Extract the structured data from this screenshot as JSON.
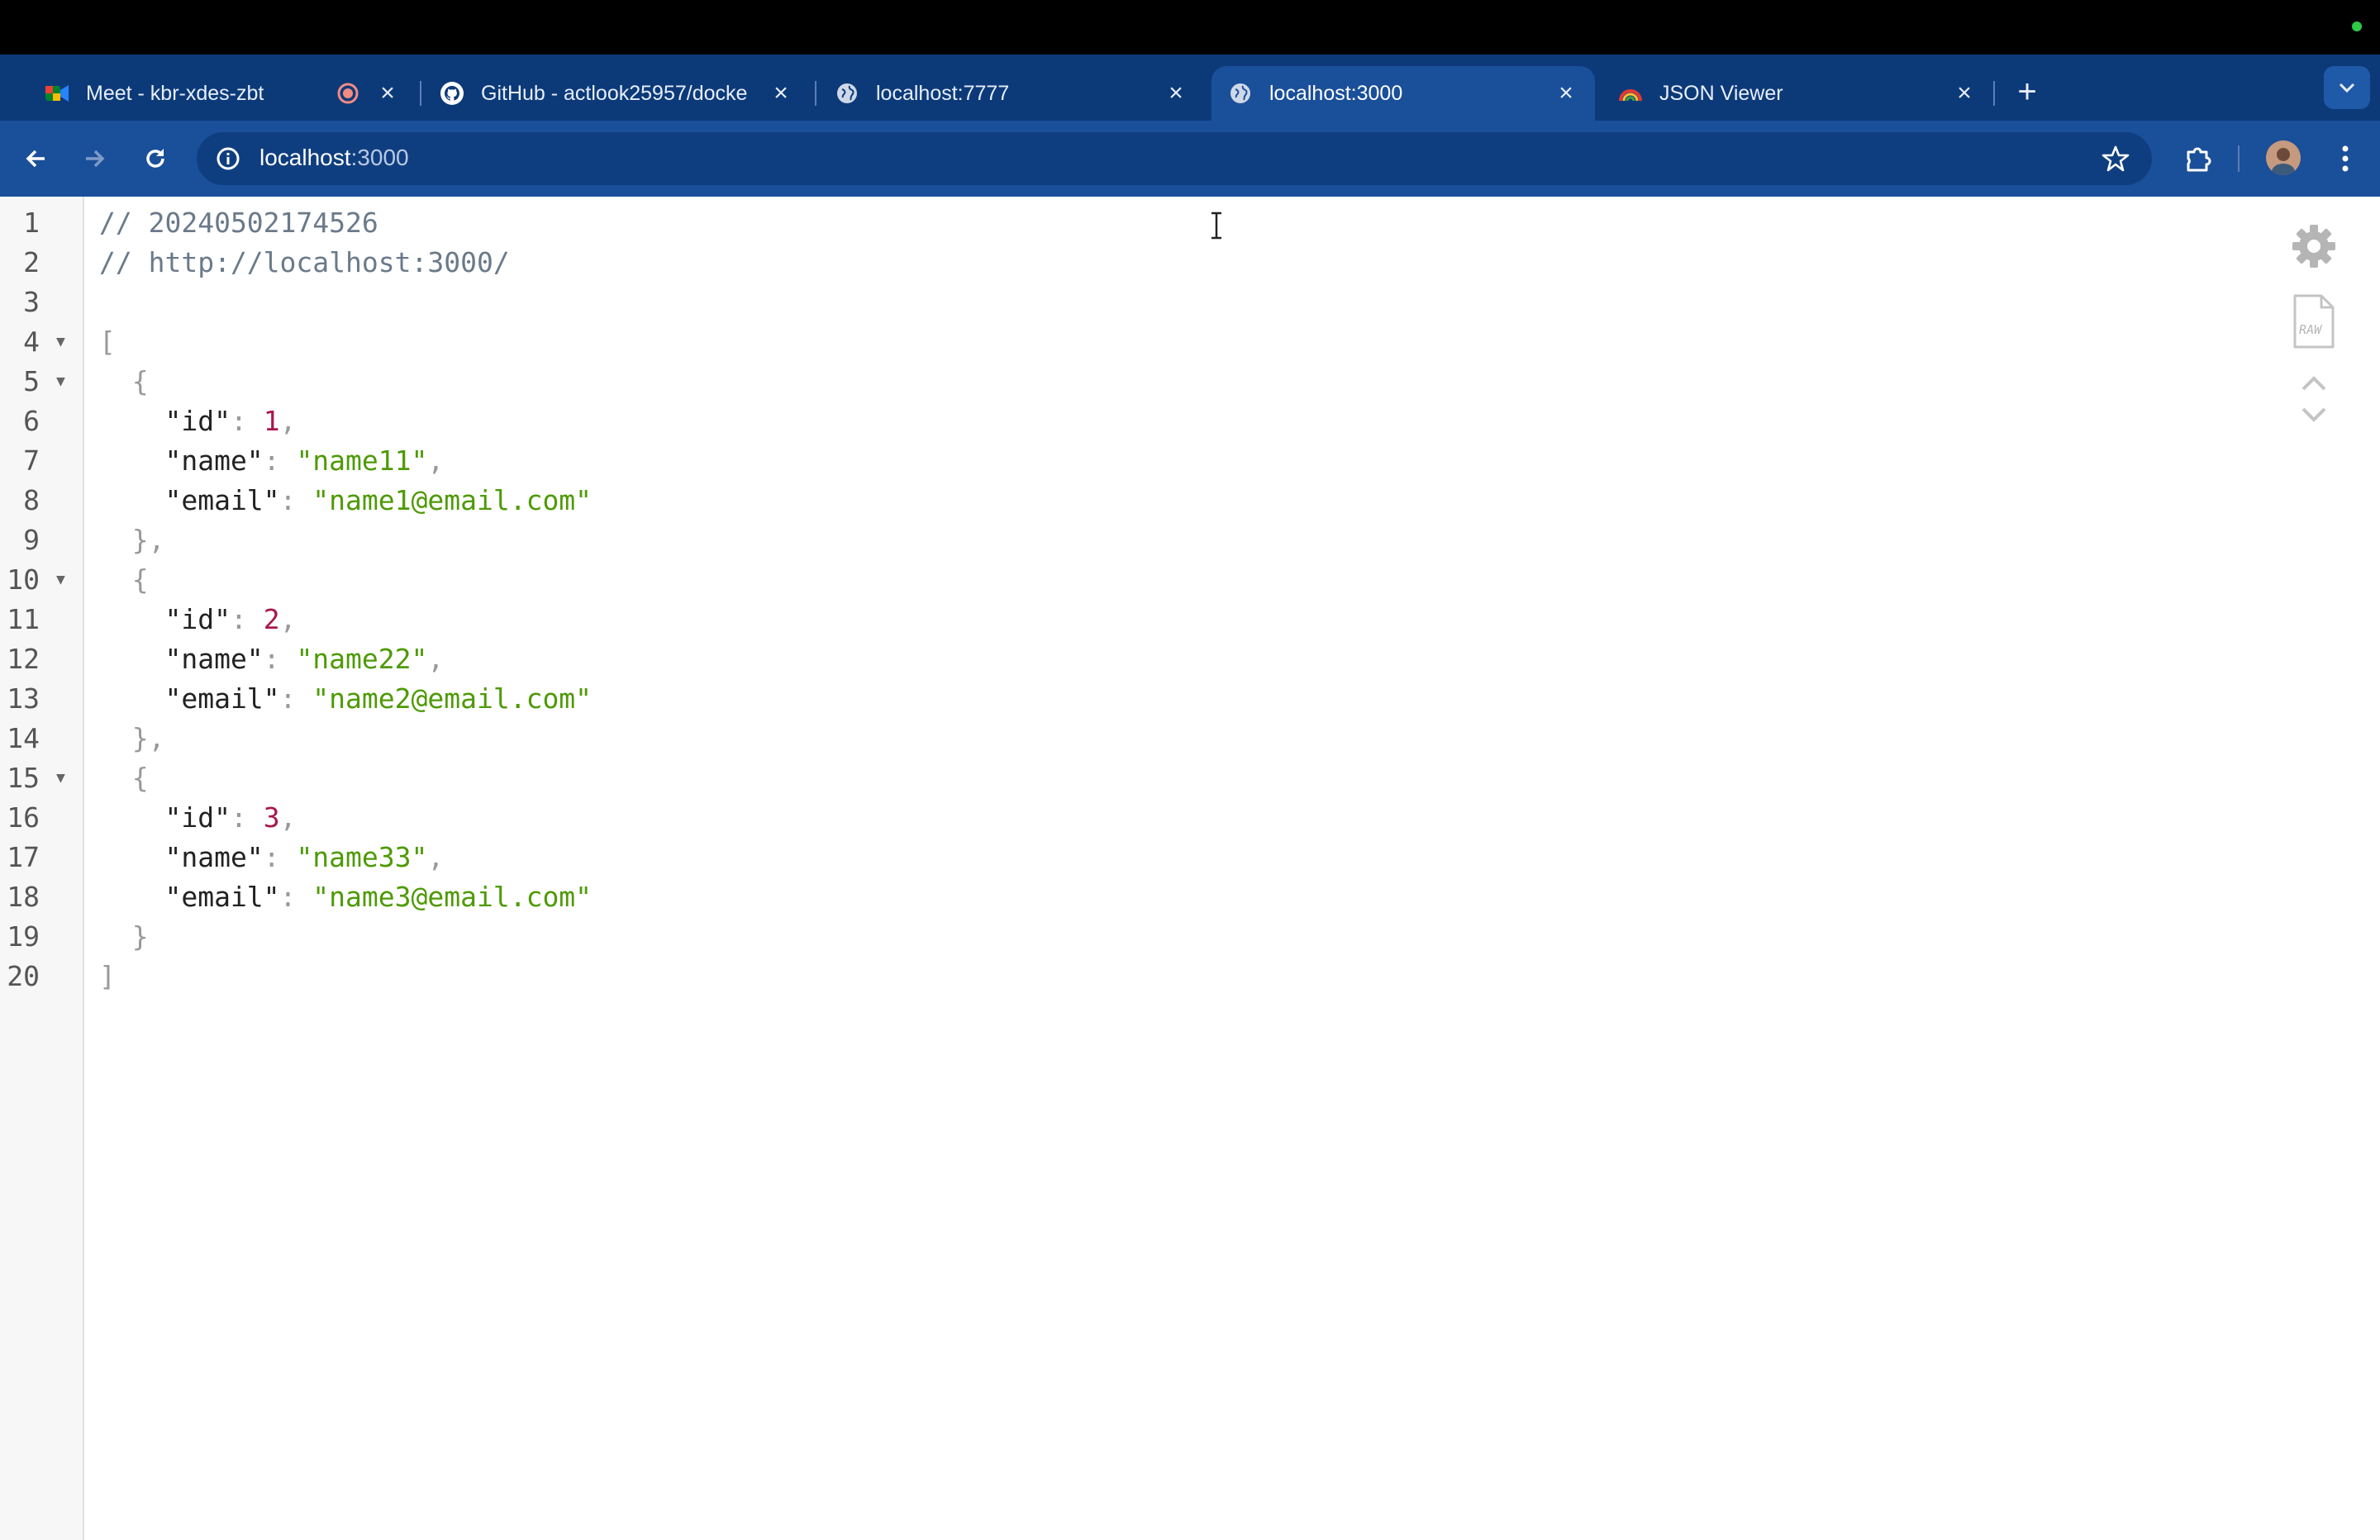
{
  "tabs": [
    {
      "title": "Meet - kbr-xdes-zbt",
      "icon": "meet-icon",
      "recording": true,
      "active": false
    },
    {
      "title": "GitHub - actlook25957/docke",
      "icon": "github-icon",
      "active": false
    },
    {
      "title": "localhost:7777",
      "icon": "globe-icon",
      "active": false
    },
    {
      "title": "localhost:3000",
      "icon": "globe-icon",
      "active": true
    },
    {
      "title": "JSON Viewer",
      "icon": "json-viewer-icon",
      "active": false
    }
  ],
  "toolbar": {
    "url_host": "localhost",
    "url_port": ":3000"
  },
  "editor": {
    "lines": [
      {
        "n": "1",
        "fold": "",
        "tokens": [
          {
            "t": "// 20240502174526",
            "c": "c"
          }
        ]
      },
      {
        "n": "2",
        "fold": "",
        "tokens": [
          {
            "t": "// http://localhost:3000/",
            "c": "c"
          }
        ]
      },
      {
        "n": "3",
        "fold": "",
        "tokens": []
      },
      {
        "n": "4",
        "fold": "▼",
        "tokens": [
          {
            "t": "[",
            "c": "p"
          }
        ]
      },
      {
        "n": "5",
        "fold": "▼",
        "tokens": [
          {
            "t": "  {",
            "c": "p"
          }
        ]
      },
      {
        "n": "6",
        "fold": "",
        "tokens": [
          {
            "t": "    \"id\"",
            "c": "k"
          },
          {
            "t": ": ",
            "c": "p"
          },
          {
            "t": "1",
            "c": "n"
          },
          {
            "t": ",",
            "c": "p"
          }
        ]
      },
      {
        "n": "7",
        "fold": "",
        "tokens": [
          {
            "t": "    \"name\"",
            "c": "k"
          },
          {
            "t": ": ",
            "c": "p"
          },
          {
            "t": "\"name11\"",
            "c": "s"
          },
          {
            "t": ",",
            "c": "p"
          }
        ]
      },
      {
        "n": "8",
        "fold": "",
        "tokens": [
          {
            "t": "    \"email\"",
            "c": "k"
          },
          {
            "t": ": ",
            "c": "p"
          },
          {
            "t": "\"name1@email.com\"",
            "c": "s"
          }
        ]
      },
      {
        "n": "9",
        "fold": "",
        "tokens": [
          {
            "t": "  },",
            "c": "p"
          }
        ]
      },
      {
        "n": "10",
        "fold": "▼",
        "tokens": [
          {
            "t": "  {",
            "c": "p"
          }
        ]
      },
      {
        "n": "11",
        "fold": "",
        "tokens": [
          {
            "t": "    \"id\"",
            "c": "k"
          },
          {
            "t": ": ",
            "c": "p"
          },
          {
            "t": "2",
            "c": "n"
          },
          {
            "t": ",",
            "c": "p"
          }
        ]
      },
      {
        "n": "12",
        "fold": "",
        "tokens": [
          {
            "t": "    \"name\"",
            "c": "k"
          },
          {
            "t": ": ",
            "c": "p"
          },
          {
            "t": "\"name22\"",
            "c": "s"
          },
          {
            "t": ",",
            "c": "p"
          }
        ]
      },
      {
        "n": "13",
        "fold": "",
        "tokens": [
          {
            "t": "    \"email\"",
            "c": "k"
          },
          {
            "t": ": ",
            "c": "p"
          },
          {
            "t": "\"name2@email.com\"",
            "c": "s"
          }
        ]
      },
      {
        "n": "14",
        "fold": "",
        "tokens": [
          {
            "t": "  },",
            "c": "p"
          }
        ]
      },
      {
        "n": "15",
        "fold": "▼",
        "tokens": [
          {
            "t": "  {",
            "c": "p"
          }
        ]
      },
      {
        "n": "16",
        "fold": "",
        "tokens": [
          {
            "t": "    \"id\"",
            "c": "k"
          },
          {
            "t": ": ",
            "c": "p"
          },
          {
            "t": "3",
            "c": "n"
          },
          {
            "t": ",",
            "c": "p"
          }
        ]
      },
      {
        "n": "17",
        "fold": "",
        "tokens": [
          {
            "t": "    \"name\"",
            "c": "k"
          },
          {
            "t": ": ",
            "c": "p"
          },
          {
            "t": "\"name33\"",
            "c": "s"
          },
          {
            "t": ",",
            "c": "p"
          }
        ]
      },
      {
        "n": "18",
        "fold": "",
        "tokens": [
          {
            "t": "    \"email\"",
            "c": "k"
          },
          {
            "t": ": ",
            "c": "p"
          },
          {
            "t": "\"name3@email.com\"",
            "c": "s"
          }
        ]
      },
      {
        "n": "19",
        "fold": "",
        "tokens": [
          {
            "t": "  }",
            "c": "p"
          }
        ]
      },
      {
        "n": "20",
        "fold": "",
        "tokens": [
          {
            "t": "]",
            "c": "p"
          }
        ]
      }
    ]
  },
  "json_viewer": {
    "raw_label": "RAW"
  },
  "colors": {
    "tabstrip": "#0c3a79",
    "toolbar": "#1a4f9a",
    "number": "#a8174f",
    "string": "#4e9a06",
    "comment": "#6a7a8a"
  }
}
